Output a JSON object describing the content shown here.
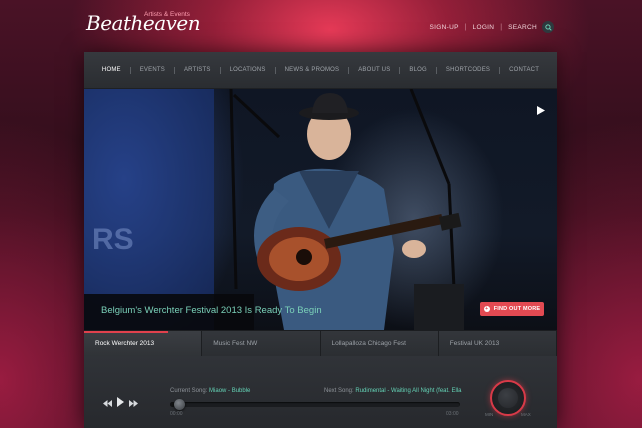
{
  "brand": {
    "logo_text": "Beatheaven",
    "tagline": "Artists & Events"
  },
  "top_links": {
    "signup": "SIGN-UP",
    "login": "LOGIN",
    "search": "SEARCH"
  },
  "nav": {
    "items": [
      "HOME",
      "EVENTS",
      "ARTISTS",
      "LOCATIONS",
      "NEWS & PROMOS",
      "ABOUT US",
      "BLOG",
      "SHORTCODES",
      "CONTACT"
    ],
    "active": "HOME"
  },
  "hero": {
    "caption": "Belgium's Werchter Festival 2013 Is Ready To Begin",
    "button_label": "FIND OUT MORE",
    "stage_text": "RS"
  },
  "tabs": [
    "Rock Werchter 2013",
    "Music Fest NW",
    "Lollapalloza Chicago Fest",
    "Festival UK 2013"
  ],
  "player": {
    "current_label": "Current Song:",
    "current_song": "Miaow - Bubble",
    "next_label": "Next Song:",
    "next_song": "Rudimental - Waiting All Night (feat. Ella",
    "time_start": "00:00",
    "time_end": "03:00",
    "dial_min": "MIN",
    "dial_max": "MAX",
    "progress_fraction": 0.03
  },
  "colors": {
    "accent": "#e24a52",
    "teal": "#64d1b5"
  },
  "icons": {
    "play": "play-icon",
    "prev": "prev-icon",
    "next": "next-icon",
    "search": "search-icon"
  }
}
